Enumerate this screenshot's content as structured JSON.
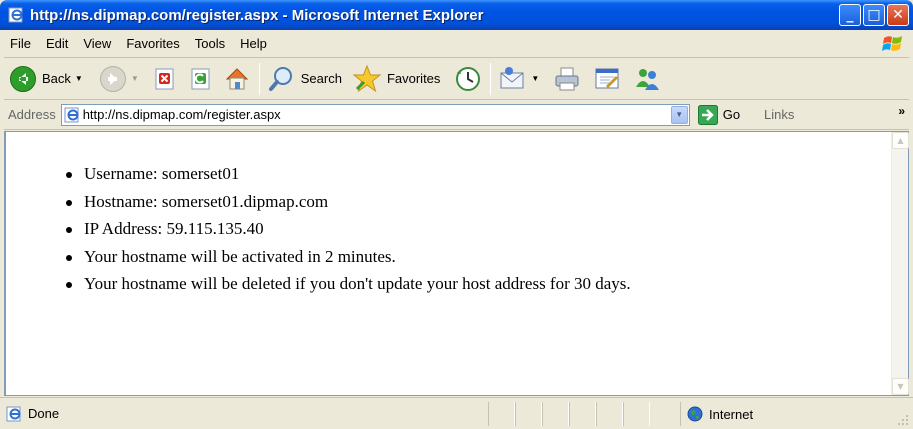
{
  "window": {
    "title": "http://ns.dipmap.com/register.aspx - Microsoft Internet Explorer",
    "controls": {
      "minimize": "_",
      "maximize": "□",
      "close": "✕"
    }
  },
  "menu": [
    "File",
    "Edit",
    "View",
    "Favorites",
    "Tools",
    "Help"
  ],
  "toolbar": {
    "back_label": "Back",
    "search_label": "Search",
    "favorites_label": "Favorites"
  },
  "address": {
    "label": "Address",
    "url": "http://ns.dipmap.com/register.aspx",
    "go_label": "Go",
    "links_label": "Links",
    "links_chevron": "»"
  },
  "content": {
    "items": [
      "Username: somerset01",
      "Hostname: somerset01.dipmap.com",
      "IP Address: 59.115.135.40",
      "Your hostname will be activated in 2 minutes.",
      "Your hostname will be deleted if you don't update your host address for 30 days."
    ]
  },
  "status": {
    "text": "Done",
    "zone": "Internet"
  },
  "icons": {
    "title": "ie-page-icon",
    "back": "back-arrow-icon",
    "forward": "forward-arrow-icon",
    "stop": "stop-icon",
    "refresh": "refresh-icon",
    "home": "home-icon",
    "search": "magnifier-icon",
    "favorites": "star-icon",
    "history": "history-icon",
    "mail": "mail-icon",
    "print": "printer-icon",
    "edit": "edit-icon",
    "messenger": "messenger-icon"
  },
  "colors": {
    "title_bar": "#0054e3",
    "chrome": "#ece9d8",
    "go_arrow": "#34a853",
    "close_button": "#c83c17"
  }
}
